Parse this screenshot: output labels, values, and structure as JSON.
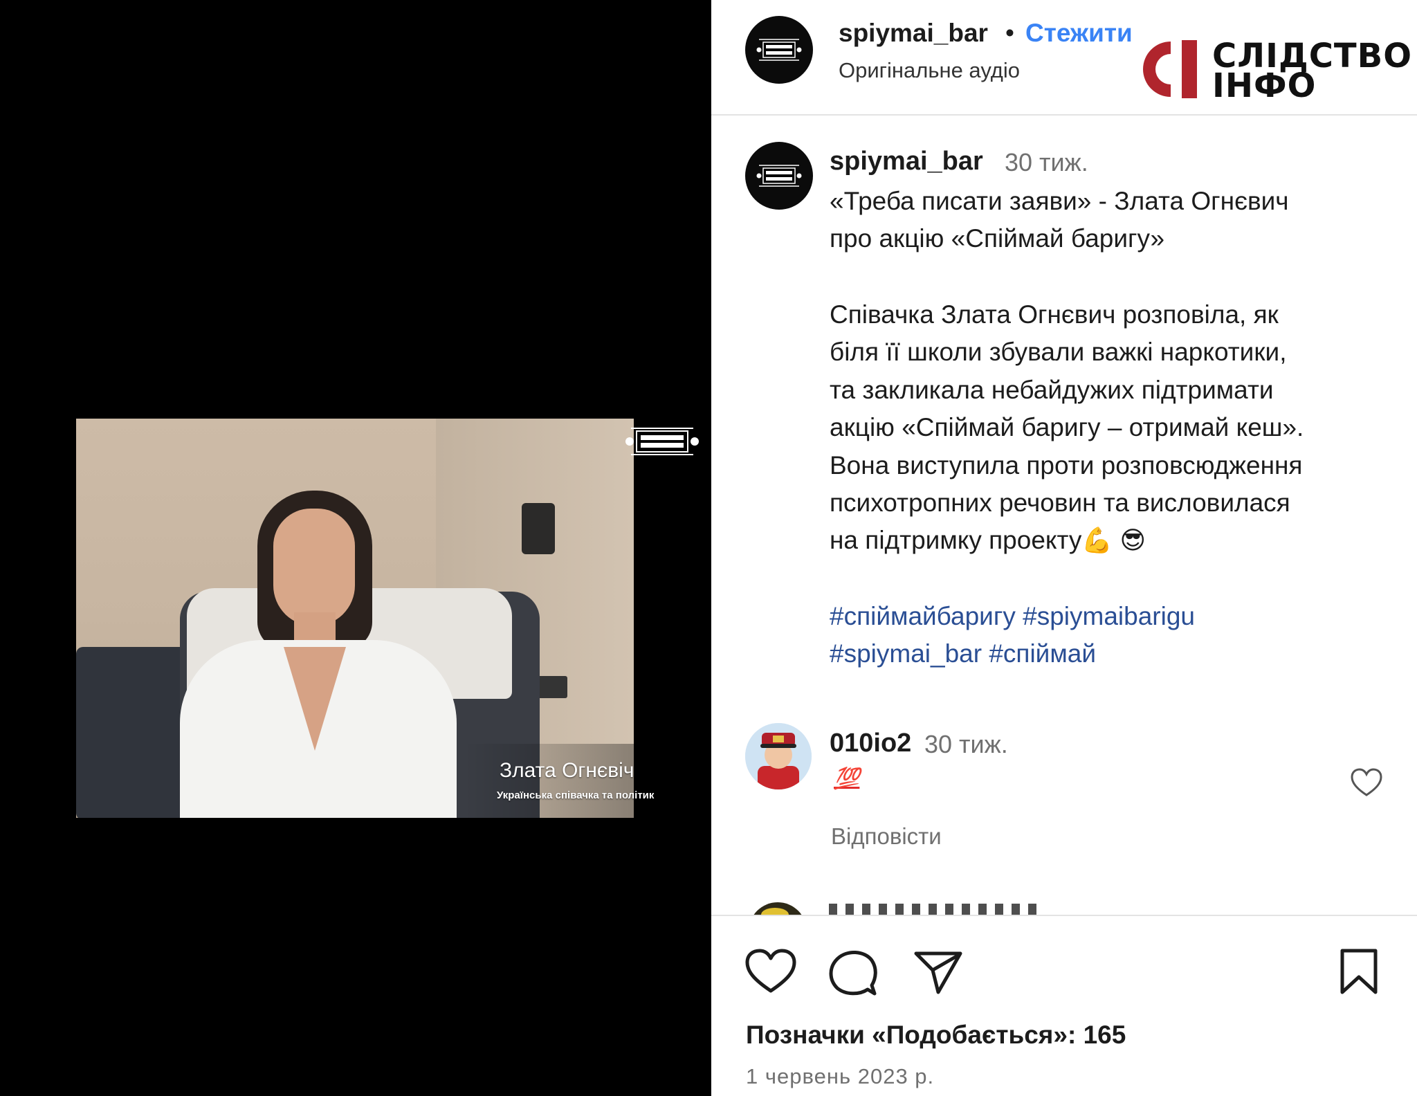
{
  "video": {
    "speaker_name": "Злата Огнєвіч",
    "speaker_role": "Українська співачка та політик"
  },
  "header": {
    "username": "spiymai_bar",
    "separator": "•",
    "follow_label": "Стежити",
    "audio_label": "Оригінальне аудіо"
  },
  "brand": {
    "line1": "СЛІДСТВО",
    "line2": "ІНФО",
    "accent_color": "#b0252d"
  },
  "caption": {
    "username": "spiymai_bar",
    "time": "30 тиж.",
    "lines": [
      "«Треба писати заяви» - Злата Огнєвич",
      "про акцію «Спіймай баригу»",
      "Співачка Злата Огнєвич розповіла, як",
      "біля її школи збували важкі наркотики,",
      "та закликала небайдужих підтримати",
      "акцію «Спіймай баригу – отримай кеш».",
      "Вона виступила проти розповсюдження",
      "психотропних речовин та висловилася",
      "на підтримку проекту"
    ],
    "emoji": [
      "💪",
      "😎"
    ],
    "hashtags": [
      "#спіймайбаригу",
      "#spiymaibarigu",
      "#spiymai_bar",
      "#спіймай"
    ]
  },
  "comment": {
    "username": "010io2",
    "time": "30 тиж.",
    "text": "💯",
    "reply_label": "Відповісти"
  },
  "actions": {
    "like_icon": "heart-icon",
    "comment_icon": "comment-bubble-icon",
    "share_icon": "paper-plane-icon",
    "save_icon": "bookmark-icon"
  },
  "likes": {
    "label": "Позначки «Подобається»:",
    "count": "165"
  },
  "post_date": "1 червень 2023 р.",
  "colors": {
    "follow": "#3a83f5",
    "hashtag": "#2a4e94",
    "muted": "#707070"
  }
}
